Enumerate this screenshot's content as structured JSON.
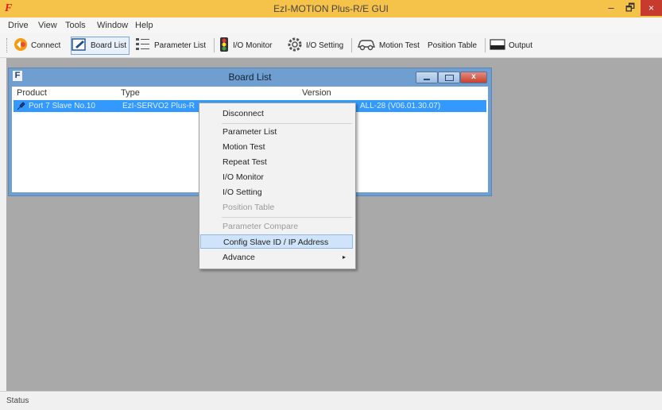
{
  "window": {
    "title": "EzI-MOTION Plus-R/E GUI",
    "logo": "F",
    "min": "–",
    "max": "🗗",
    "close": "×"
  },
  "menu": [
    "Drive",
    "View",
    "Tools",
    "Window",
    "Help"
  ],
  "toolbar": {
    "connect": "Connect",
    "board_list": "Board List",
    "parameter_list": "Parameter List",
    "io_monitor": "I/O Monitor",
    "io_setting": "I/O Setting",
    "motion_test": "Motion Test",
    "position_table": "Position Table",
    "output": "Output"
  },
  "board_list": {
    "title": "Board List",
    "logo": "F",
    "close": "x",
    "columns": [
      "Product",
      "Type",
      "Version"
    ],
    "rows": [
      {
        "product": "Port 7 Slave No.10",
        "type": "EzI-SERVO2 Plus-R",
        "version": "ALL-28 (V06.01.30.07)"
      }
    ]
  },
  "context_menu": {
    "items": [
      {
        "label": "Disconnect",
        "enabled": true
      },
      {
        "label": "Parameter List",
        "enabled": true
      },
      {
        "label": "Motion Test",
        "enabled": true
      },
      {
        "label": "Repeat Test",
        "enabled": true
      },
      {
        "label": "I/O Monitor",
        "enabled": true
      },
      {
        "label": "I/O Setting",
        "enabled": true
      },
      {
        "label": "Position Table",
        "enabled": false
      },
      {
        "label": "Parameter Compare",
        "enabled": false
      },
      {
        "label": "Config Slave ID / IP Address",
        "enabled": true,
        "highlighted": true
      },
      {
        "label": "Advance",
        "enabled": true,
        "submenu": true
      }
    ],
    "submenu_arrow": "▸"
  },
  "status": {
    "text": "Status"
  },
  "colors": {
    "titlebar": "#f6c34a",
    "workspace": "#a9a9a9",
    "selection": "#3399ff",
    "mdi_frame": "#6f9fd0"
  }
}
